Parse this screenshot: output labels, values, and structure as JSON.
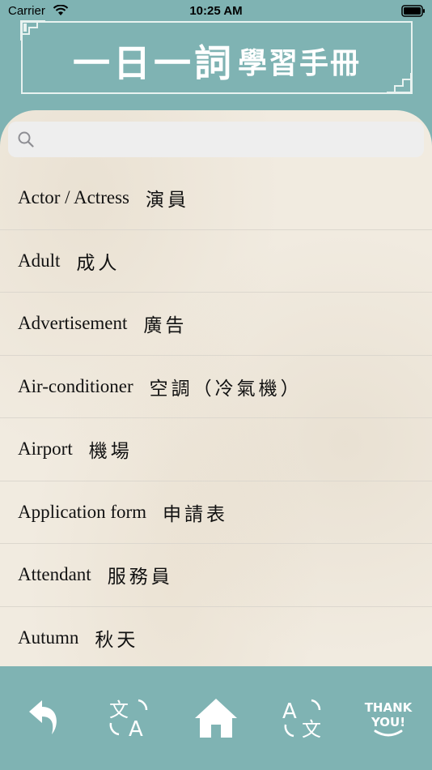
{
  "status": {
    "carrier": "Carrier",
    "time": "10:25 AM"
  },
  "header": {
    "title_main": "一日一詞",
    "title_sub": "學習手冊"
  },
  "search": {
    "placeholder": "",
    "value": ""
  },
  "words": [
    {
      "en": "Actor / Actress",
      "zh": "演員"
    },
    {
      "en": "Adult",
      "zh": "成人"
    },
    {
      "en": "Advertisement",
      "zh": "廣告"
    },
    {
      "en": "Air-conditioner",
      "zh": "空調（冷氣機）"
    },
    {
      "en": "Airport",
      "zh": "機場"
    },
    {
      "en": "Application form",
      "zh": "申請表"
    },
    {
      "en": "Attendant",
      "zh": "服務員"
    },
    {
      "en": "Autumn",
      "zh": "秋天"
    }
  ],
  "toolbar": {
    "back_icon": "back-arrow-icon",
    "translate_zh_en_icon": "translate-zh-to-en-icon",
    "home_icon": "home-icon",
    "translate_en_zh_icon": "translate-en-to-zh-icon",
    "thank_you_label_1": "THANK",
    "thank_you_label_2": "YOU!"
  },
  "colors": {
    "teal": "#7fb3b3",
    "paper": "#f1ebe0",
    "header_line": "#e8f2f0"
  }
}
